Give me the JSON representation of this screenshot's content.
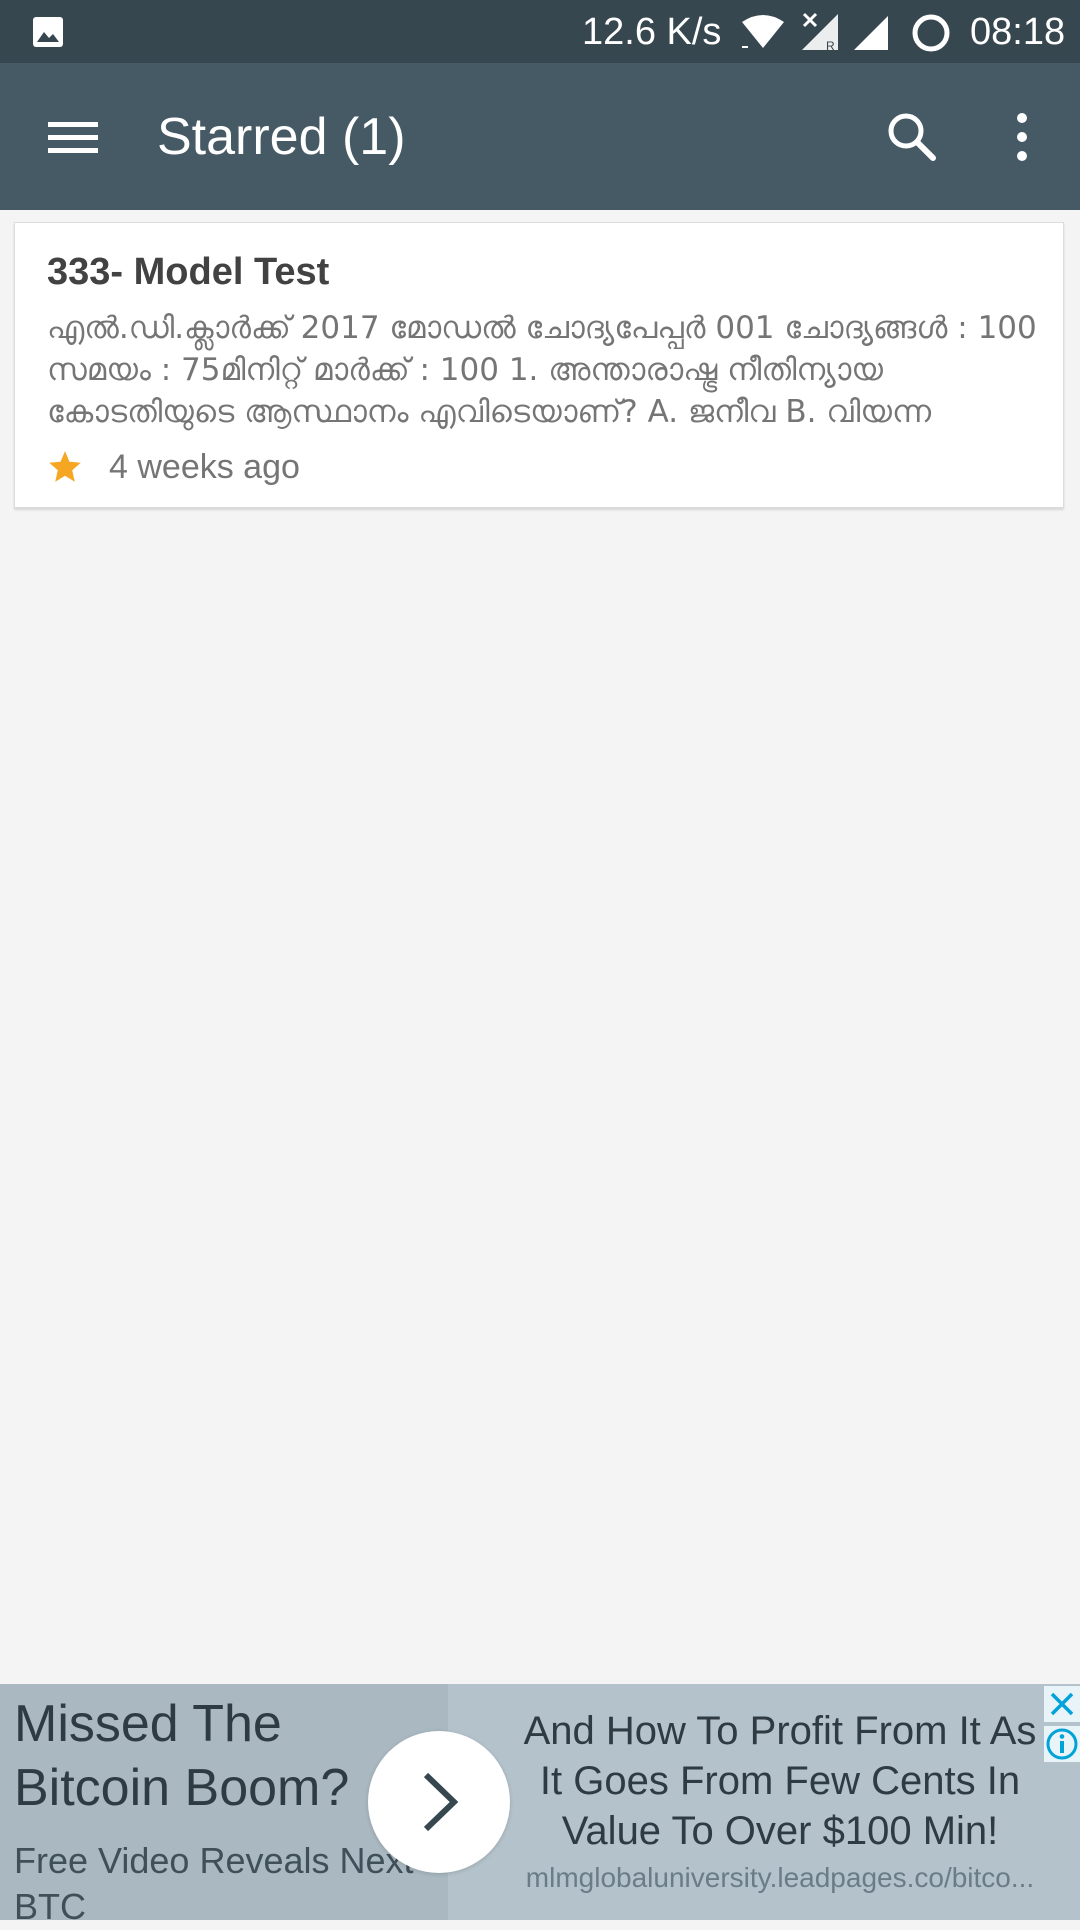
{
  "status_bar": {
    "icons": [
      "gallery-icon",
      "wifi-icon",
      "signal-no-sim-icon",
      "signal-icon",
      "sync-circle-icon"
    ],
    "speed": "12.6 K/s",
    "time": "08:18"
  },
  "toolbar": {
    "title": "Starred (1)",
    "icons": [
      "menu-icon",
      "search-icon",
      "more-vert-icon"
    ]
  },
  "starred_items": [
    {
      "title": "333- Model Test",
      "excerpt": "എൽ.ഡി.ക്ലാർക്ക് 2017 മോഡൽ ചോദ്യപേപ്പർ 001 ചോദ്യങ്ങൾ : 100 സമയം : 75മിനിറ്റ് മാർക്ക് : 100 1. അന്താരാഷ്ട്ര നീതിന്യായ കോടതിയുടെ ആസ്ഥാനം എവിടെയാണ്? A. ജനീവ B. വിയന്ന",
      "time": "4 weeks ago",
      "star_color": "#f5a623"
    }
  ],
  "ad": {
    "headline": "Missed The Bitcoin Boom?",
    "subline": "Free Video Reveals Next BTC",
    "body": "And How To Profit From It As It Goes From Few Cents In Value To Over $100 Min!",
    "url": "mlmglobaluniversity.leadpages.co/bitco..."
  },
  "colors": {
    "status_bar": "#37474f",
    "toolbar": "#455a64",
    "background": "#f4f4f4",
    "accent_star": "#f5a623",
    "ad_info": "#00a3d9"
  }
}
